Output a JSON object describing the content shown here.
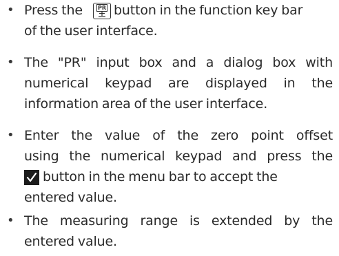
{
  "bullet_symbol": "•",
  "items": [
    {
      "lines": [
        {
          "before_icon": "Press the",
          "after_icon": "button in the function key bar"
        },
        "of the user interface."
      ],
      "icon": {
        "name": "pr-key-icon",
        "label": "PR"
      }
    },
    {
      "lines": [
        "The \"PR\" input box and a dialog box with",
        "numerical keypad are displayed in the",
        "information area of the user interface."
      ]
    },
    {
      "lines": [
        "Enter the value of the zero point offset",
        "using the numerical keypad and press the",
        {
          "after_icon": "button in the menu bar to accept the"
        },
        "entered value."
      ],
      "icon": {
        "name": "checkmark-key-icon"
      }
    },
    {
      "lines": [
        "The measuring range is extended by the",
        "entered value."
      ]
    }
  ]
}
